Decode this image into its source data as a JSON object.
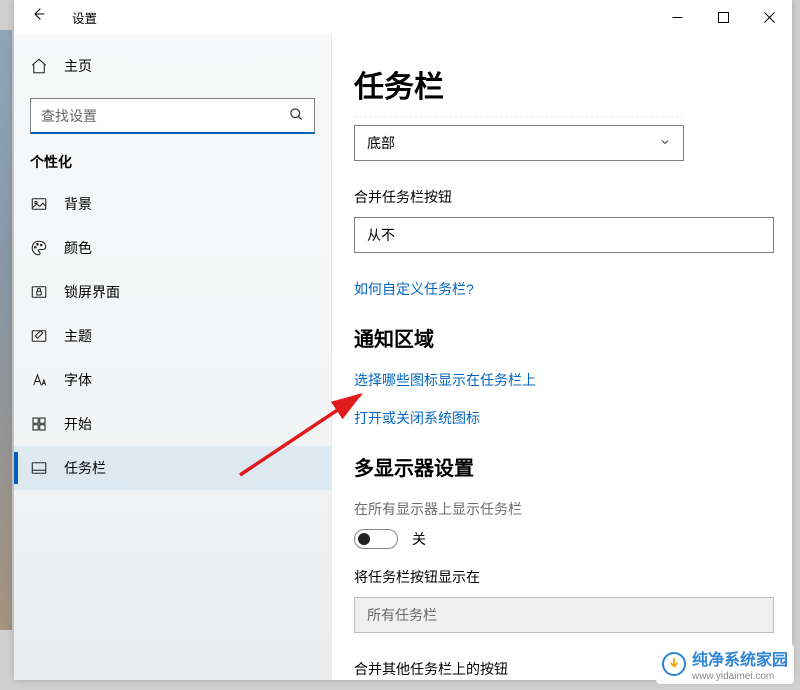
{
  "titlebar": {
    "title": "设置"
  },
  "sidebar": {
    "home": "主页",
    "search_placeholder": "查找设置",
    "section": "个性化",
    "items": [
      {
        "icon": "image",
        "label": "背景"
      },
      {
        "icon": "palette",
        "label": "颜色"
      },
      {
        "icon": "lock",
        "label": "锁屏界面"
      },
      {
        "icon": "theme",
        "label": "主题"
      },
      {
        "icon": "font",
        "label": "字体"
      },
      {
        "icon": "start",
        "label": "开始"
      },
      {
        "icon": "taskbar",
        "label": "任务栏"
      }
    ],
    "active_index": 6
  },
  "main": {
    "title": "任务栏",
    "position_field_value": "底部",
    "combine_label": "合并任务栏按钮",
    "combine_value": "从不",
    "customize_link": "如何自定义任务栏?",
    "notif_section": "通知区域",
    "notif_link1": "选择哪些图标显示在任务栏上",
    "notif_link2": "打开或关闭系统图标",
    "multi_section": "多显示器设置",
    "multi_desc": "在所有显示器上显示任务栏",
    "toggle_state": "关",
    "showon_label": "将任务栏按钮显示在",
    "showon_value": "所有任务栏",
    "combine_other_label": "合并其他任务栏上的按钮"
  },
  "watermark": {
    "name": "纯净系统家园",
    "url": "www.yidaimei.com"
  }
}
